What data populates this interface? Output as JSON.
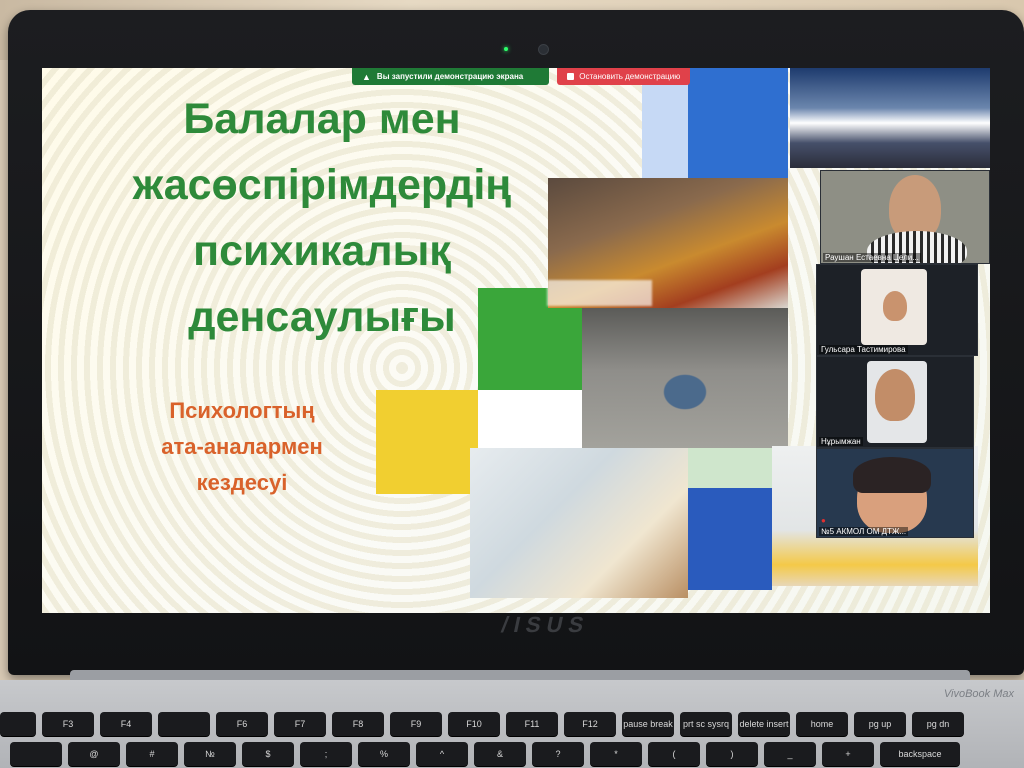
{
  "brand": "/ISUS",
  "deck_model": "VivoBook Max",
  "zoom_bar": {
    "status_text": "Вы запустили демонстрацию экрана",
    "stop_text": "Остановить демонстрацию"
  },
  "slide": {
    "title": "Балалар мен\nжасөспірімдердің\nпсихикалық\nденсаулығы",
    "subtitle": "Психологтың\nата-аналармен\nкездесуі"
  },
  "participants": [
    {
      "name": "Раушан Естаевна Цели..."
    },
    {
      "name": "Гульсара Тастимирова"
    },
    {
      "name": "Нұрымжан"
    },
    {
      "name": "№5 АКМОЛ ОМ ДТЖ..."
    }
  ],
  "keyboard": {
    "top_row": [
      "",
      "F3",
      "F4",
      "",
      "F6",
      "F7",
      "F8",
      "F9",
      "F10",
      "F11",
      "F12",
      "pause break",
      "prt sc sysrq",
      "delete insert",
      "home",
      "pg up",
      "pg dn"
    ],
    "second_row": [
      "",
      "@",
      "#",
      "№",
      "$",
      ";",
      "%",
      "^",
      "&",
      "?",
      "*",
      "(",
      ")",
      "_",
      "+",
      "backspace"
    ]
  },
  "colors": {
    "title_green": "#2e8a3a",
    "subtitle_orange": "#d9622b",
    "share_green": "#1f7a36",
    "stop_red": "#e0414a"
  }
}
